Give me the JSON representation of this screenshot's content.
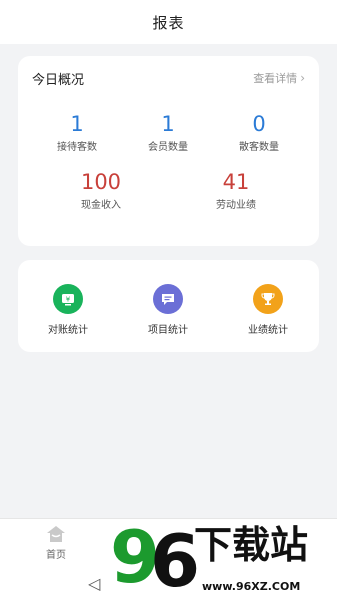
{
  "header": {
    "title": "报表"
  },
  "overview": {
    "title": "今日概况",
    "detail_link": "查看详情",
    "stats_top": [
      {
        "value": "1",
        "label": "接待客数"
      },
      {
        "value": "1",
        "label": "会员数量"
      },
      {
        "value": "0",
        "label": "散客数量"
      }
    ],
    "stats_bottom": [
      {
        "value": "100",
        "label": "现金收入"
      },
      {
        "value": "41",
        "label": "劳动业绩"
      }
    ]
  },
  "tools": [
    {
      "label": "对账统计",
      "icon": "reconciliation-icon",
      "color": "#19b35b"
    },
    {
      "label": "项目统计",
      "icon": "project-stats-icon",
      "color": "#6b6fd6"
    },
    {
      "label": "业绩统计",
      "icon": "trophy-icon",
      "color": "#f2a21a"
    }
  ],
  "tabbar": {
    "home_label": "首页"
  },
  "watermark": {
    "brand": "96下载站",
    "url": "www.96XZ.COM"
  }
}
